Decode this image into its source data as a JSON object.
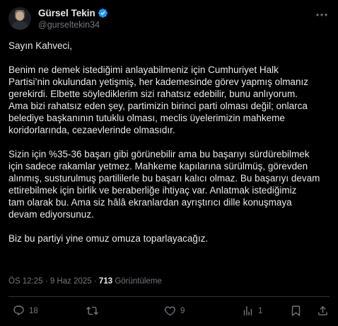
{
  "author": {
    "name": "Gürsel Tekin",
    "handle": "@gurseltekin34",
    "verified": true,
    "avatar_icon": "profile-photo"
  },
  "tweet": {
    "paragraphs": [
      "Sayın Kahveci,",
      "Benim ne demek istediğimi anlayabilmeniz için Cumhuriyet Halk\nPartisi’nin okulundan yetişmiş, her kademesinde görev yapmış olmanız\ngerekirdi. Elbette söylediklerim sizi rahatsız edebilir, bunu anlıyorum.\nAma bizi rahatsız eden şey, partimizin birinci parti olması değil; onlarca\nbelediye başkanının tutuklu olması, meclis üyelerimizin mahkeme\nkoridorlarında, cezaevlerinde olmasıdır.",
      "Sizin için %35-36 başarı gibi görünebilir ama bu başarıyı sürdürebilmek\niçin sadece rakamlar yetmez. Mahkeme kapılarına sürülmüş, görevden\nalınmış, susturulmuş partililerle bu başarı kalıcı olmaz. Bu başarıyı devam\nettirebilmek için birlik ve beraberliğe ihtiyaç var. Anlatmak istediğimiz\ntam olarak bu. Ama siz hâlâ ekranlardan ayrıştırıcı dille konuşmaya\ndevam ediyorsunuz.",
      "Biz bu partiyi yine omuz omuza toparlayacağız."
    ],
    "time": "ÖS 12:25",
    "separator": "·",
    "date": "9 Haz 2025",
    "views_count": "713",
    "views_label": "Görüntüleme"
  },
  "actions": {
    "reply": {
      "icon": "reply-icon",
      "count": "18"
    },
    "retweet": {
      "icon": "retweet-icon",
      "count": ""
    },
    "like": {
      "icon": "heart-icon",
      "count": "9"
    },
    "views": {
      "icon": "views-icon",
      "count": "1"
    },
    "bookmark": {
      "icon": "bookmark-icon"
    },
    "share": {
      "icon": "share-icon"
    }
  },
  "colors": {
    "background": "#000000",
    "text": "#e7e9ea",
    "muted": "#71767b",
    "verified": "#1d9bf0",
    "divider": "#2f3336"
  }
}
